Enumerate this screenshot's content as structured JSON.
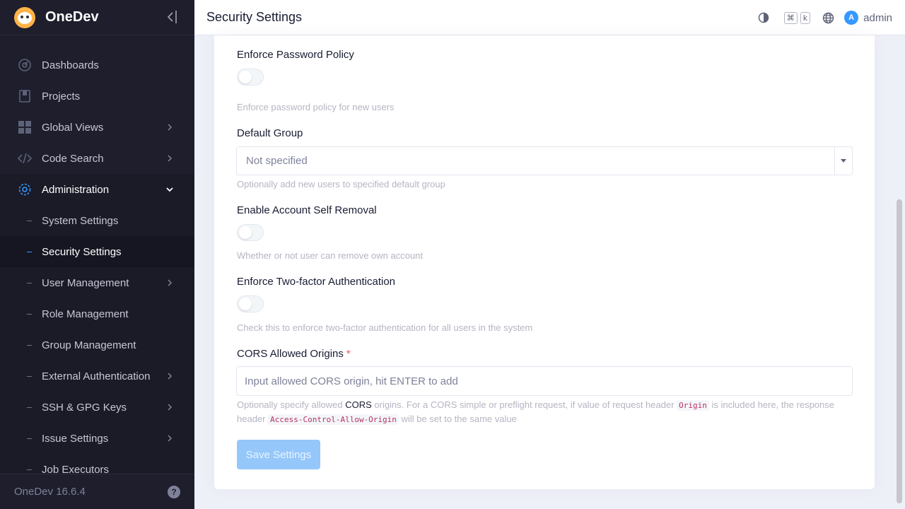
{
  "brand": {
    "name": "OneDev"
  },
  "header": {
    "title": "Security Settings",
    "kbd_cmd": "⌘",
    "kbd_k": "k",
    "avatar_letter": "A",
    "user": "admin"
  },
  "sidebar": {
    "items": [
      {
        "label": "Dashboards",
        "icon": "dashboard-icon"
      },
      {
        "label": "Projects",
        "icon": "projects-icon"
      },
      {
        "label": "Global Views",
        "icon": "grid-icon"
      },
      {
        "label": "Code Search",
        "icon": "code-icon"
      },
      {
        "label": "Administration",
        "icon": "gear-icon"
      }
    ],
    "admin_items": [
      {
        "label": "System Settings"
      },
      {
        "label": "Security Settings"
      },
      {
        "label": "User Management"
      },
      {
        "label": "Role Management"
      },
      {
        "label": "Group Management"
      },
      {
        "label": "External Authentication"
      },
      {
        "label": "SSH & GPG Keys"
      },
      {
        "label": "Issue Settings"
      },
      {
        "label": "Job Executors"
      }
    ],
    "version": "OneDev 16.6.4",
    "help_glyph": "?"
  },
  "form": {
    "password_policy": {
      "label": "Enforce Password Policy",
      "enabled": false,
      "help": "Enforce password policy for new users"
    },
    "default_group": {
      "label": "Default Group",
      "value": "Not specified",
      "help": "Optionally add new users to specified default group"
    },
    "self_removal": {
      "label": "Enable Account Self Removal",
      "enabled": false,
      "help": "Whether or not user can remove own account"
    },
    "two_factor": {
      "label": "Enforce Two-factor Authentication",
      "enabled": false,
      "help": "Check this to enforce two-factor authentication for all users in the system"
    },
    "cors": {
      "label": "CORS Allowed Origins",
      "required_mark": "*",
      "placeholder": "Input allowed CORS origin, hit ENTER to add",
      "help_part1": "Optionally specify allowed",
      "help_cors": "CORS",
      "help_part2": "origins. For a CORS simple or preflight request, if value of request header",
      "help_code1": "Origin",
      "help_part3": "is included here, the response header",
      "help_code2": "Access-Control-Allow-Origin",
      "help_part4": "will be set to the same value"
    },
    "save_label": "Save Settings"
  },
  "colors": {
    "sidebar_bg": "#1e1e2d",
    "accent": "#3699ff",
    "save_disabled": "#95c7fb",
    "required": "#f64e60"
  }
}
